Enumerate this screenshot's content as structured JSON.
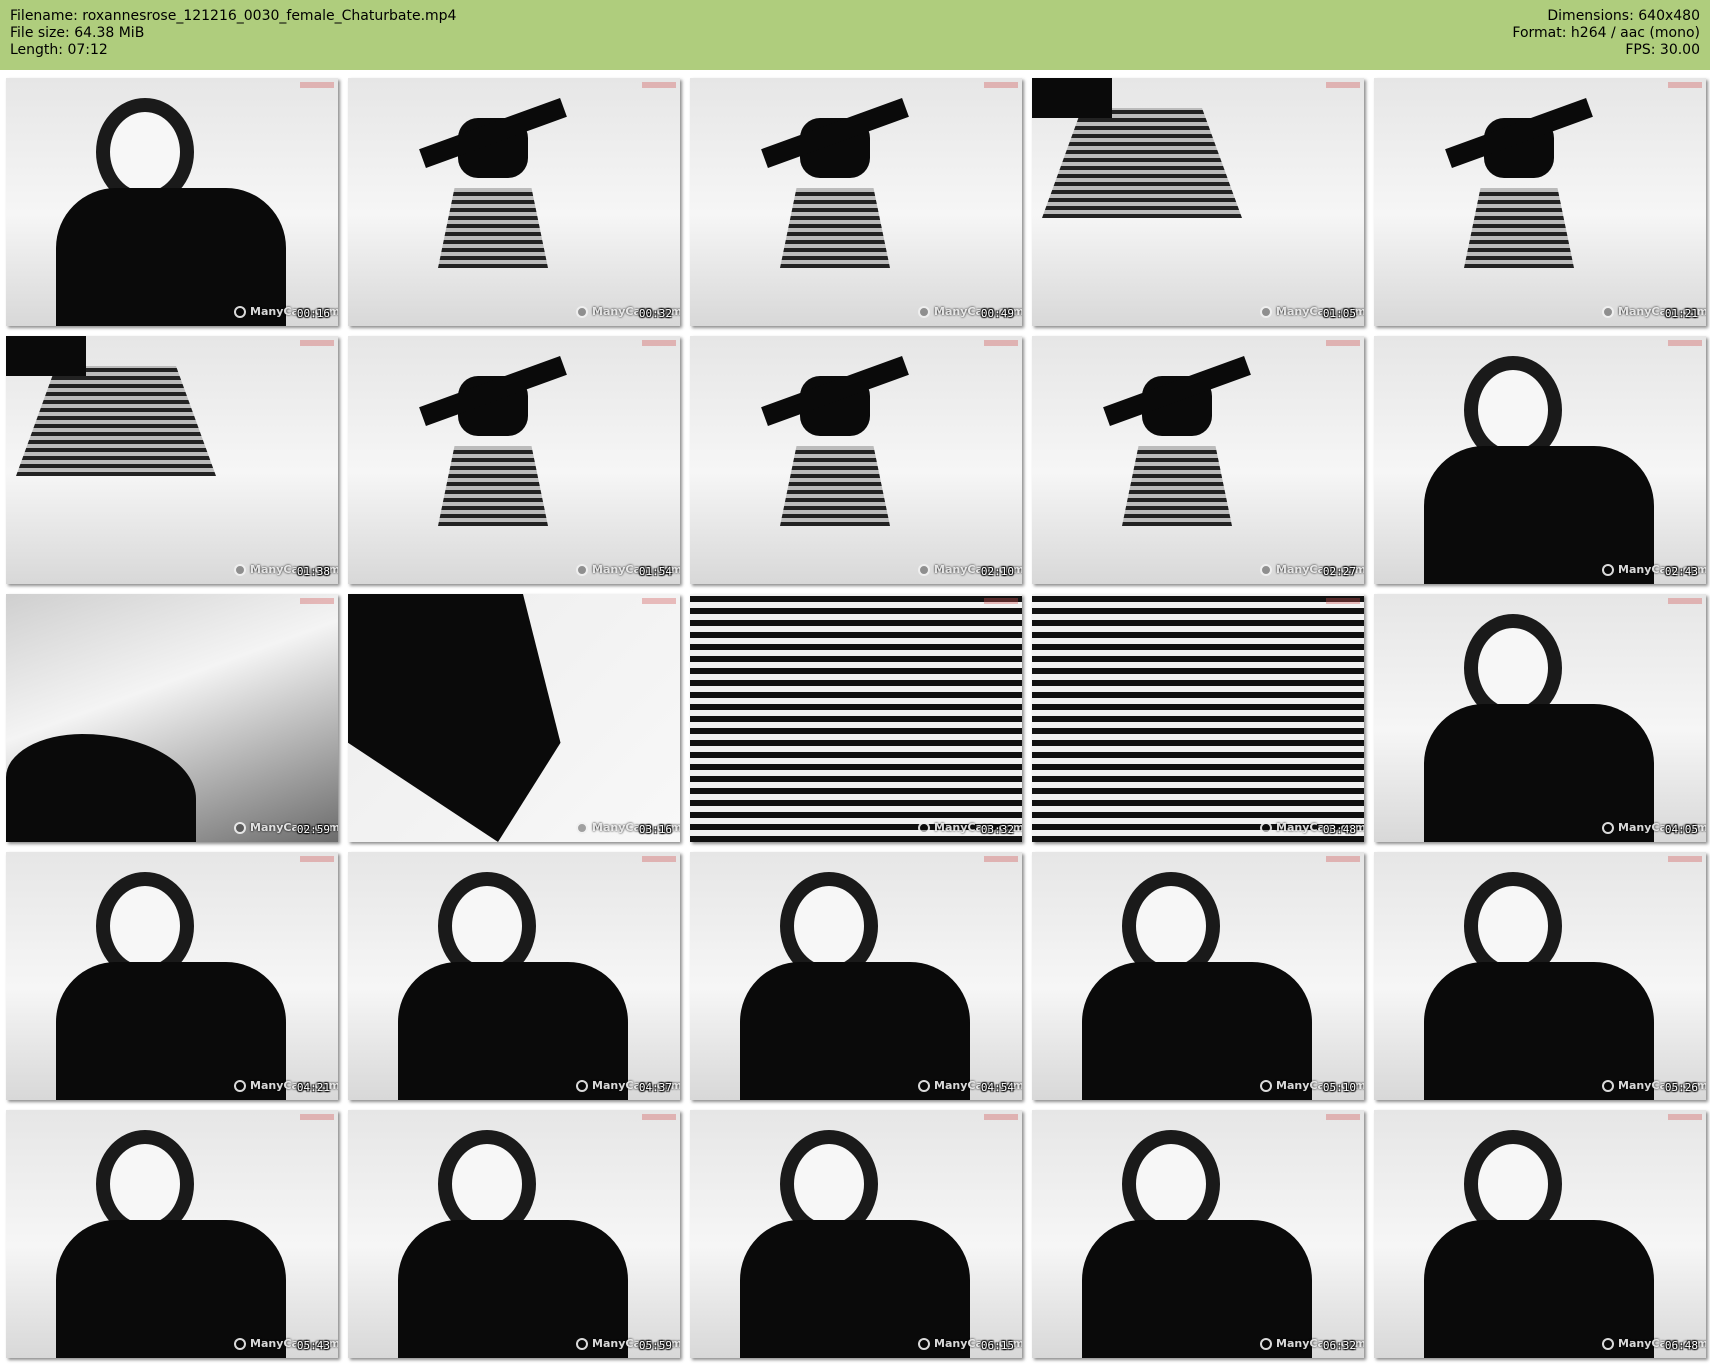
{
  "header": {
    "background": "#afcd7d",
    "left": [
      "Filename: roxannesrose_121216_0030_female_Chaturbate.mp4",
      "File size: 64.38 MiB",
      "Length: 07:12"
    ],
    "right": [
      "Dimensions: 640x480",
      "Format: h264 / aac (mono)",
      "FPS: 30.00"
    ]
  },
  "thumbnails": [
    {
      "time": "00:16",
      "scene": "face"
    },
    {
      "time": "00:32",
      "scene": "back"
    },
    {
      "time": "00:49",
      "scene": "dance"
    },
    {
      "time": "01:05",
      "scene": "skirt"
    },
    {
      "time": "01:21",
      "scene": "back"
    },
    {
      "time": "01:38",
      "scene": "skirt"
    },
    {
      "time": "01:54",
      "scene": "back"
    },
    {
      "time": "02:10",
      "scene": "dance"
    },
    {
      "time": "02:27",
      "scene": "back"
    },
    {
      "time": "02:43",
      "scene": "face"
    },
    {
      "time": "02:59",
      "scene": "floor"
    },
    {
      "time": "03:16",
      "scene": "closeup"
    },
    {
      "time": "03:32",
      "scene": "stripes"
    },
    {
      "time": "03:48",
      "scene": "stripes"
    },
    {
      "time": "04:05",
      "scene": "face"
    },
    {
      "time": "04:21",
      "scene": "seated"
    },
    {
      "time": "04:37",
      "scene": "seated"
    },
    {
      "time": "04:54",
      "scene": "seated"
    },
    {
      "time": "05:10",
      "scene": "seated"
    },
    {
      "time": "05:26",
      "scene": "seated"
    },
    {
      "time": "05:43",
      "scene": "seated"
    },
    {
      "time": "05:59",
      "scene": "seated"
    },
    {
      "time": "06:15",
      "scene": "seated"
    },
    {
      "time": "06:32",
      "scene": "seated"
    },
    {
      "time": "06:48",
      "scene": "seated"
    }
  ],
  "watermark": "ManyCam.com"
}
